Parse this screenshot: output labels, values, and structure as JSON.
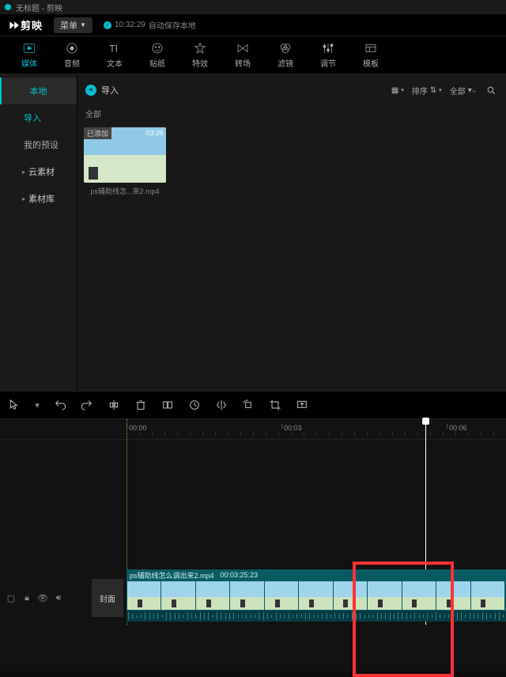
{
  "titlebar": {
    "text": "无标题 - 剪映"
  },
  "appbar": {
    "logo": "剪映",
    "menu": "菜单",
    "autosave_time": "10:32:29",
    "autosave_text": "自动保存本地"
  },
  "top_tabs": [
    {
      "id": "media",
      "label": "媒体",
      "active": true
    },
    {
      "id": "audio",
      "label": "音频"
    },
    {
      "id": "text",
      "label": "文本"
    },
    {
      "id": "sticker",
      "label": "贴纸"
    },
    {
      "id": "effect",
      "label": "特效"
    },
    {
      "id": "transition",
      "label": "转场"
    },
    {
      "id": "filter",
      "label": "滤镜"
    },
    {
      "id": "adjust",
      "label": "调节"
    },
    {
      "id": "template",
      "label": "模板"
    }
  ],
  "sidebar": {
    "items": [
      {
        "label": "本地",
        "type": "header",
        "active": true
      },
      {
        "label": "导入",
        "type": "sub",
        "accent": true
      },
      {
        "label": "我的预设",
        "type": "sub"
      },
      {
        "label": "云素材",
        "type": "header"
      },
      {
        "label": "素材库",
        "type": "header"
      }
    ]
  },
  "content_bar": {
    "import": "导入",
    "all": "全部",
    "sort": "排序",
    "filter_all": "全部"
  },
  "media_items": [
    {
      "added_tag": "已添加",
      "duration": "03:26",
      "name": "ps辅助线怎...来2.mp4"
    }
  ],
  "toolbar_tools": [
    "pointer",
    "undo",
    "redo",
    "split",
    "delete",
    "freeze",
    "speed",
    "mirror",
    "rotate",
    "crop",
    "export-frame"
  ],
  "ruler": {
    "marks": [
      {
        "pos": 160,
        "label": "00:00"
      },
      {
        "pos": 356,
        "label": "00:03"
      },
      {
        "pos": 565,
        "label": "00:06"
      }
    ]
  },
  "track": {
    "cover": "封面",
    "clip_name": "ps辅助线怎么调出来2.mp4",
    "clip_dur": "00:03:25:23"
  }
}
